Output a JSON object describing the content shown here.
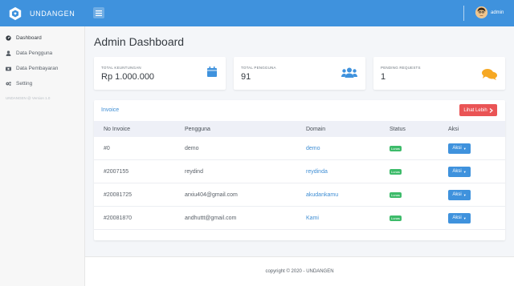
{
  "brand": {
    "name": "UNDANGEN"
  },
  "user": {
    "name": "admin"
  },
  "sidebar": {
    "items": [
      {
        "label": "Dashboard",
        "icon": "dashboard-icon"
      },
      {
        "label": "Data Pengguna",
        "icon": "user-icon"
      },
      {
        "label": "Data Pembayaran",
        "icon": "money-icon"
      },
      {
        "label": "Setting",
        "icon": "gears-icon"
      }
    ],
    "version": "UNDANGEN @ Version 1.0"
  },
  "page": {
    "title": "Admin Dashboard"
  },
  "stats": [
    {
      "label": "TOTAL KEUNTUNGAN",
      "value": "Rp 1.000.000",
      "icon": "calendar-icon",
      "color": "#3f92dd"
    },
    {
      "label": "TOTAL PENGGUNA",
      "value": "91",
      "icon": "users-icon",
      "color": "#3f92dd"
    },
    {
      "label": "PENDING REQUESTS",
      "value": "1",
      "icon": "comments-icon",
      "color": "#f6a823"
    }
  ],
  "invoice": {
    "title": "Invoice",
    "more_label": "Lihat Lebih",
    "columns": [
      "No Invoice",
      "Pengguna",
      "Domain",
      "Status",
      "Aksi"
    ],
    "rows": [
      {
        "no": "#0",
        "user": "demo",
        "domain": "demo",
        "status": "Lunas",
        "action": "Aksi"
      },
      {
        "no": "#2007155",
        "user": "reydind",
        "domain": "reydinda",
        "status": "Lunas",
        "action": "Aksi"
      },
      {
        "no": "#20081725",
        "user": "arxiu404@gmail.com",
        "domain": "akudankamu",
        "status": "Lunas",
        "action": "Aksi"
      },
      {
        "no": "#20081870",
        "user": "andhuttt@gmail.com",
        "domain": "Kami",
        "status": "Lunas",
        "action": "Aksi"
      }
    ]
  },
  "footer": {
    "text": "copyright © 2020 - UNDANGEN"
  },
  "colors": {
    "primary": "#3f92dd",
    "danger": "#ea5455",
    "success": "#3dbb6a",
    "warning": "#f6a823"
  }
}
